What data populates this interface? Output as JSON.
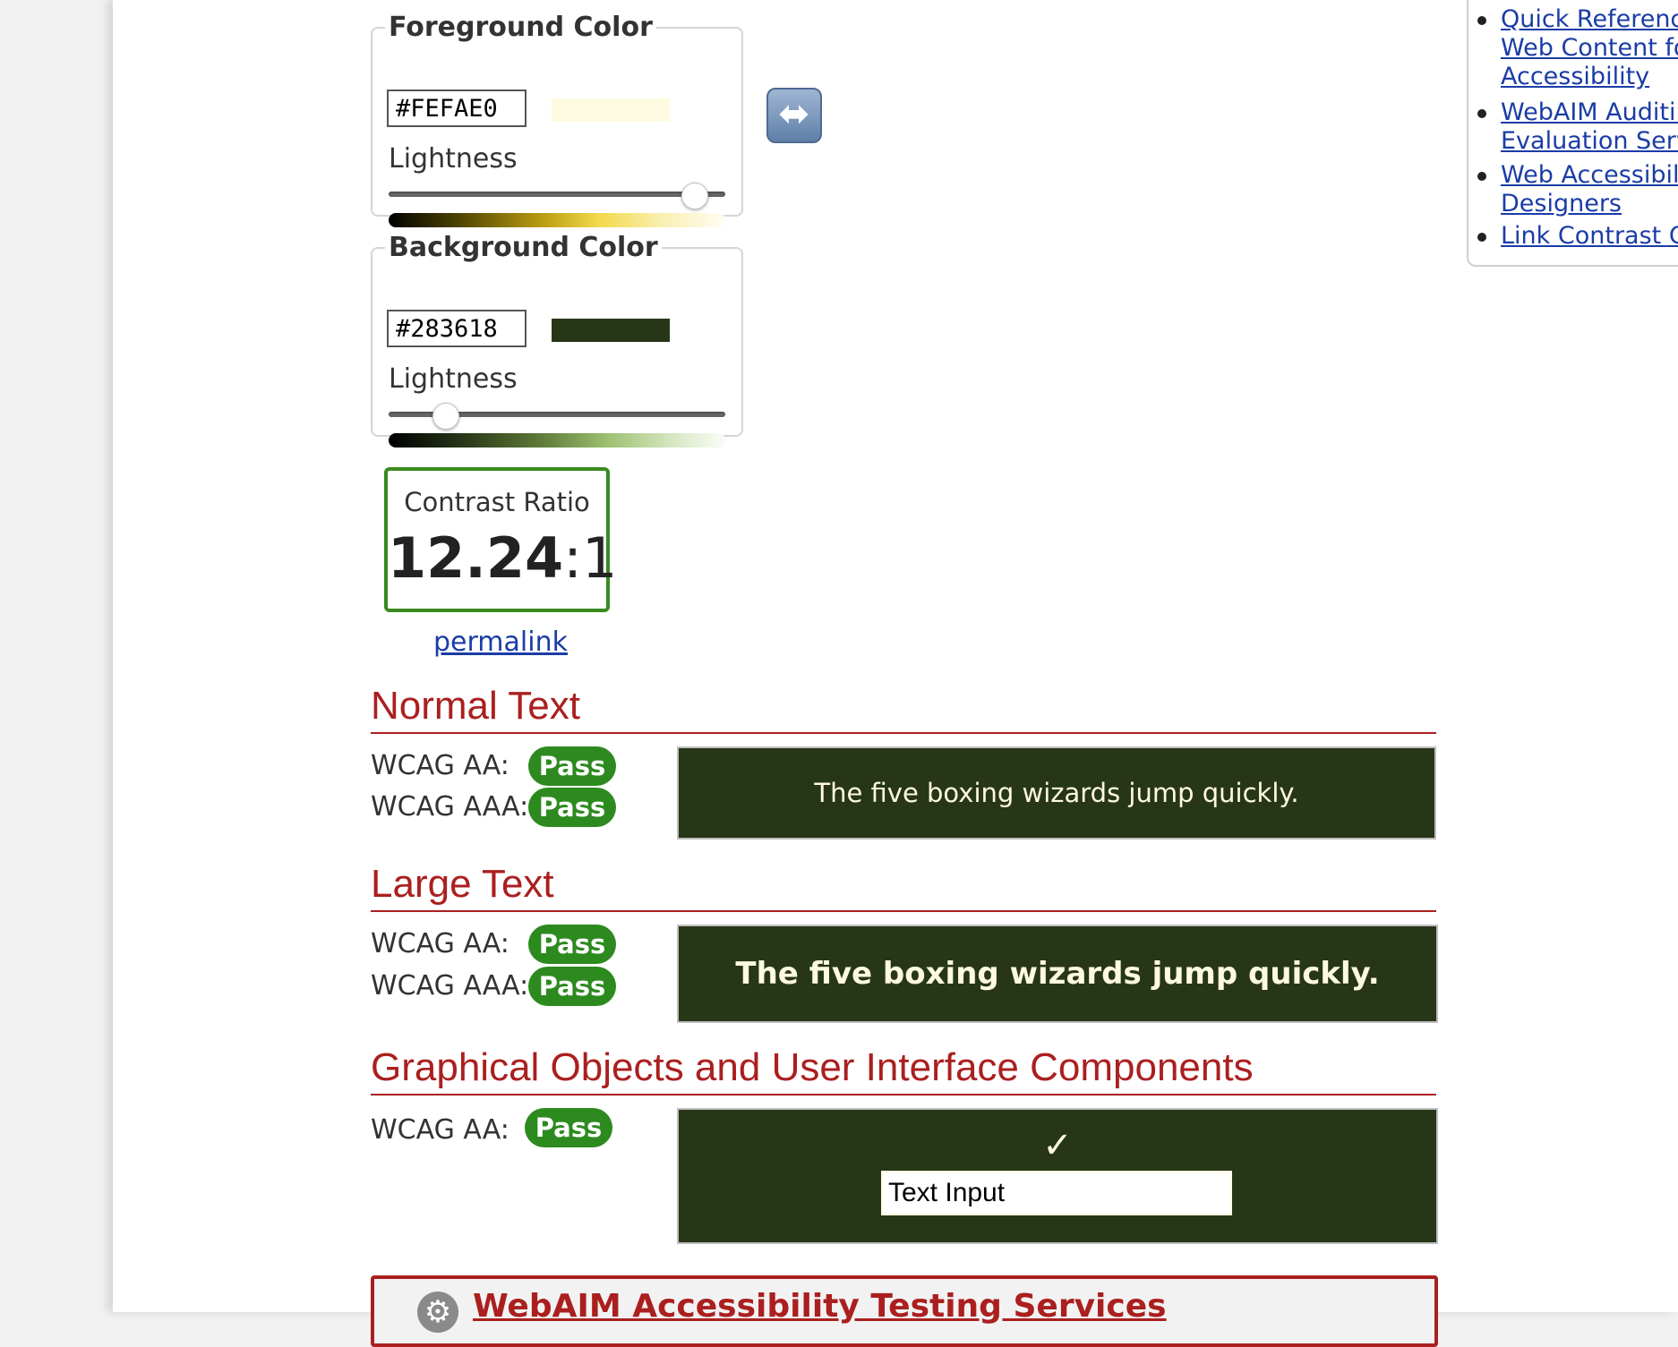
{
  "foreground": {
    "legend": "Foreground Color",
    "hex": "#FEFAE0",
    "swatch_color": "#FEFAE0",
    "lightness_label": "Lightness",
    "lightness_level": 0.91
  },
  "background": {
    "legend": "Background Color",
    "hex": "#283618",
    "swatch_color": "#283618",
    "lightness_label": "Lightness",
    "lightness_level": 0.17
  },
  "swap": {
    "icon": "left-right-arrow-icon",
    "glyph": "⬌"
  },
  "contrast": {
    "label": "Contrast Ratio",
    "value": "12.24",
    "suffix": ":1"
  },
  "permalink": "permalink",
  "normal_text": {
    "heading": "Normal Text",
    "aa_label": "WCAG AA:",
    "aa_result": "Pass",
    "aaa_label": "WCAG AAA:",
    "aaa_result": "Pass",
    "sample": "The five boxing wizards jump quickly."
  },
  "large_text": {
    "heading": "Large Text",
    "aa_label": "WCAG AA:",
    "aa_result": "Pass",
    "aaa_label": "WCAG AAA:",
    "aaa_result": "Pass",
    "sample": "The five boxing wizards jump quickly."
  },
  "graphical": {
    "heading": "Graphical Objects and User Interface Components",
    "aa_label": "WCAG AA:",
    "aa_result": "Pass",
    "check_glyph": "✓",
    "input_value": "Text Input"
  },
  "sidebar": {
    "links": [
      "Quick Reference:\nWeb Content for\nAccessibility",
      "WebAIM Auditing\nEvaluation Servic",
      "Web Accessibility\nDesigners",
      "Link Contrast Ch"
    ]
  },
  "promo": {
    "title": "WebAIM Accessibility Testing Services"
  },
  "colors": {
    "accent_red": "#ab1f1f",
    "pass_green": "#2d8a1f",
    "link_blue": "#1a3ca6"
  }
}
